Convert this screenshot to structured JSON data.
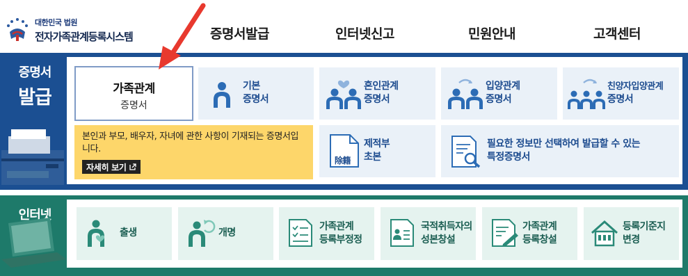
{
  "header": {
    "org_name": "대한민국 법원",
    "system_name": "전자가족관계등록시스템",
    "nav": [
      {
        "label": "증명서발급"
      },
      {
        "label": "인터넷신고"
      },
      {
        "label": "민원안내"
      },
      {
        "label": "고객센터"
      }
    ]
  },
  "certificates": {
    "section_title_line1": "증명서",
    "section_title_line2": "발급",
    "active_card": {
      "title": "가족관계",
      "subtitle": "증명서"
    },
    "tooltip": {
      "description": "본인과 부모, 배우자, 자녀에 관한 사항이 기재되는 증명서입니다.",
      "more_label": "자세히 보기"
    },
    "cards": [
      {
        "line1": "기본",
        "line2": "증명서"
      },
      {
        "line1": "혼인관계",
        "line2": "증명서"
      },
      {
        "line1": "입양관계",
        "line2": "증명서"
      },
      {
        "line1": "친양자입양관계",
        "line2": "증명서"
      },
      {
        "line1": "제적부",
        "line2": "초본",
        "icon_text": "除籍"
      },
      {
        "line1": "필요한 정보만 선택하여 발급할 수 있는",
        "line2": "특정증명서"
      }
    ]
  },
  "internet_report": {
    "section_title_line1": "인터넷",
    "section_title_line2": "신고",
    "cards": [
      {
        "line1": "출생"
      },
      {
        "line1": "개명"
      },
      {
        "line1": "가족관계",
        "line2": "등록부정정"
      },
      {
        "line1": "국적취득자의",
        "line2": "성본창설"
      },
      {
        "line1": "가족관계",
        "line2": "등록창설"
      },
      {
        "line1": "등록기준지",
        "line2": "변경"
      }
    ]
  },
  "colors": {
    "band_blue": "#1b4f92",
    "band_green": "#1e7a6a",
    "tooltip_yellow": "#fdd66a",
    "card_blue": "#eaf1f8",
    "card_green": "#e5f3ef",
    "arrow_red": "#e8392e"
  }
}
